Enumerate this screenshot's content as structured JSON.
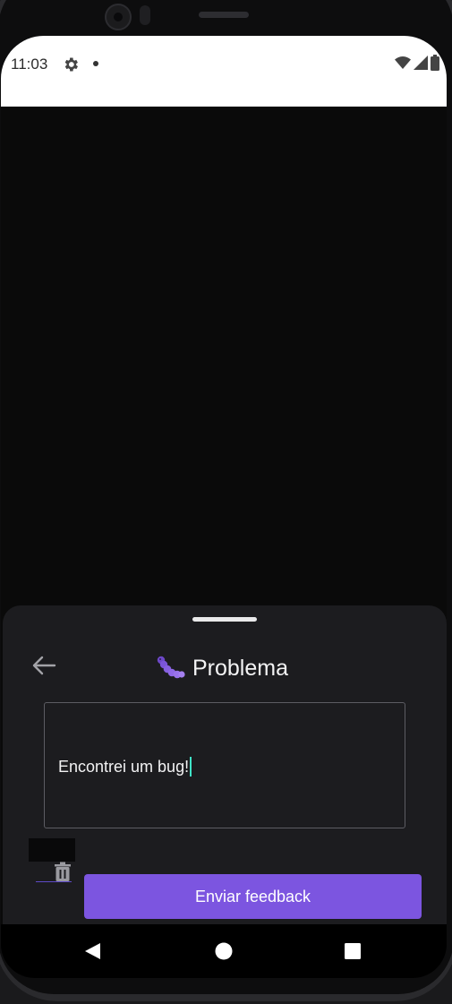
{
  "status_bar": {
    "time": "11:03",
    "icons": [
      "gear-icon",
      "notification-dot-icon",
      "wifi-icon",
      "signal-icon",
      "battery-icon"
    ]
  },
  "feedback_sheet": {
    "back_icon": "arrow-left-icon",
    "title_icon": "caterpillar-bug-icon",
    "title": "Problema",
    "message_value": "Encontrei um bug!",
    "screenshot_attachment_delete_icon": "trash-icon",
    "submit_label": "Enviar feedback"
  },
  "nav_bar": {
    "icons": [
      "back-triangle-icon",
      "home-circle-icon",
      "recents-square-icon"
    ]
  },
  "colors": {
    "accent": "#7c55e0",
    "caret": "#3fe3c7",
    "sheet_background": "#1c1c1f",
    "app_background": "#0a0a0a"
  }
}
